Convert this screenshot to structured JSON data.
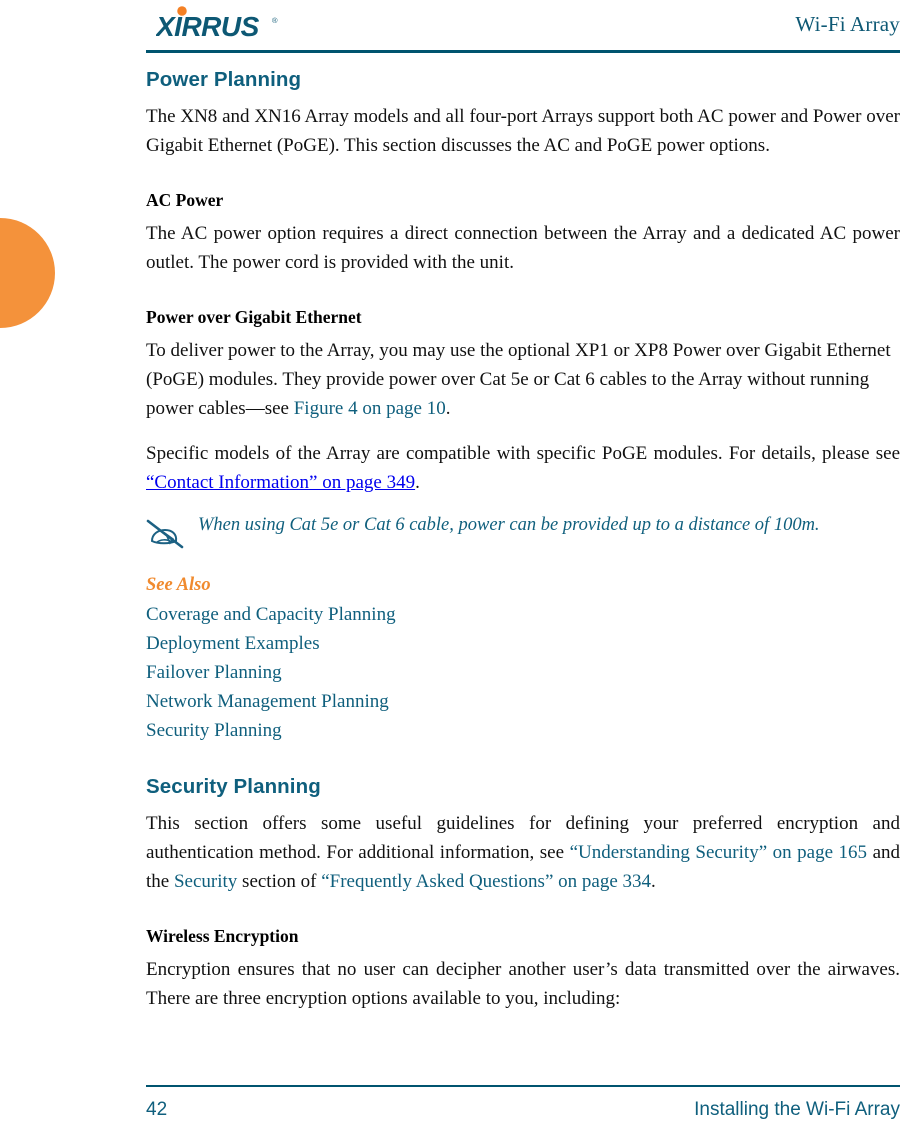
{
  "brand": {
    "logo_text": "XIRRUS",
    "logo_trademark": "®",
    "logo_dot_color": "#f48024",
    "logo_word_color": "#0d5874"
  },
  "header": {
    "doc_title": "Wi-Fi Array",
    "rule_color": "#00546f"
  },
  "edge_tab": {
    "name": "chapter-thumb-tab",
    "color": "#f4923b"
  },
  "sections": {
    "power_planning": {
      "heading": "Power Planning",
      "intro": "The XN8 and XN16 Array models and all four-port Arrays support both AC power and Power over Gigabit Ethernet (PoGE). This section discusses the AC and PoGE power options."
    },
    "ac_power": {
      "heading": "AC Power",
      "body": "The AC power option requires a direct connection between the Array and a dedicated AC power outlet. The power cord is provided with the unit."
    },
    "poge": {
      "heading": "Power over Gigabit Ethernet",
      "body_before_link": "To deliver power to the Array, you may use the optional XP1 or XP8 Power over Gigabit Ethernet (PoGE) modules. They provide power over Cat 5e or Cat 6 cables to the Array without running power cables—see ",
      "link_figure": "Figure 4 on page 10",
      "body_after_link": ".",
      "compat_before_link": "Specific models of the Array are compatible with specific PoGE modules. For details, please see ",
      "link_contact": "“Contact Information” on page 349",
      "compat_after_link": "."
    },
    "note": {
      "icon": "pencil-note-icon",
      "text": "When using Cat 5e or Cat 6 cable, power can be provided up to a distance of 100m."
    },
    "see_also": {
      "heading": "See Also",
      "items": [
        "Coverage and Capacity Planning",
        "Deployment Examples",
        "Failover Planning",
        "Network Management Planning",
        "Security Planning"
      ]
    },
    "security_planning": {
      "heading": "Security Planning",
      "part1": "This section offers some useful guidelines for defining your preferred encryption and authentication method. For additional information, see ",
      "link_understanding": "“Understanding Security” on page 165",
      "part2": " and the ",
      "link_security": "Security",
      "part3": " section of ",
      "link_faq": "“Frequently Asked Questions” on page 334",
      "part4": "."
    },
    "wireless_encryption": {
      "heading": "Wireless Encryption",
      "body": "Encryption ensures that no user can decipher another user’s data transmitted over the airwaves. There are three encryption options available to you, including:"
    }
  },
  "footer": {
    "page_number": "42",
    "title": "Installing the Wi-Fi Array"
  },
  "colors": {
    "teal": "#0f5f7d",
    "orange": "#f08a2e",
    "rule": "#00546f",
    "body_text": "#111111"
  }
}
